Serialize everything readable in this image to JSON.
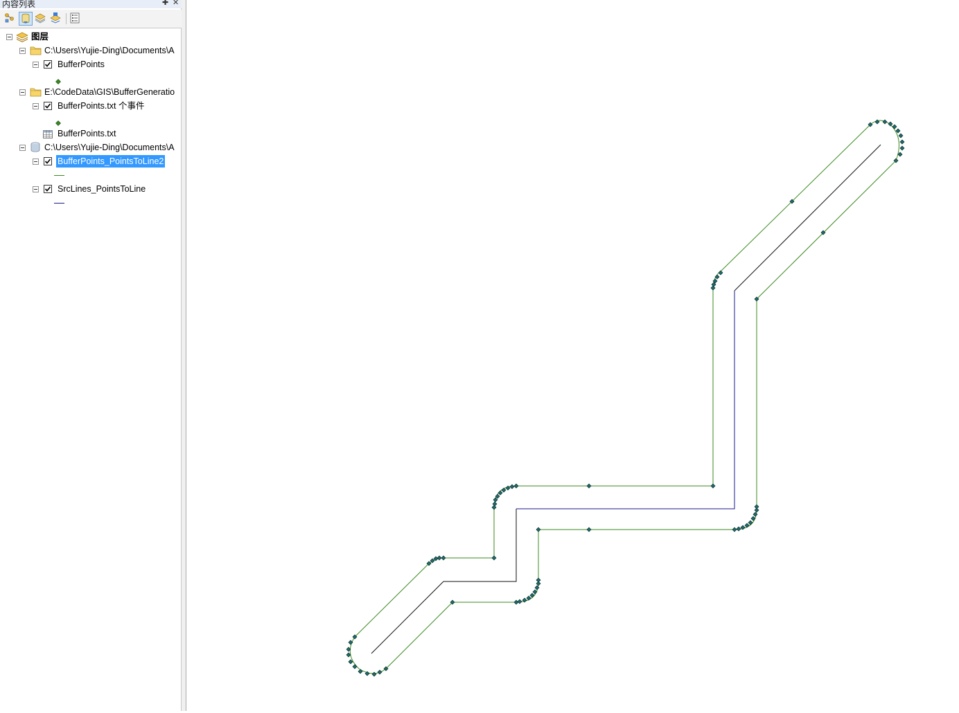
{
  "toc": {
    "title": "内容列表",
    "toolbar": [
      "list-by-drawing-order",
      "list-by-source",
      "list-by-visibility",
      "list-by-selection",
      "options"
    ],
    "root_label": "图层",
    "groups": [
      {
        "path": "C:\\Users\\Yujie-Ding\\Documents\\A",
        "icon": "folder-icon",
        "layers": [
          {
            "label": "BufferPoints",
            "checked": true,
            "symbol": "point"
          }
        ]
      },
      {
        "path": "E:\\CodeData\\GIS\\BufferGeneratio",
        "icon": "folder-icon",
        "layers": [
          {
            "label": "BufferPoints.txt 个事件",
            "checked": true,
            "symbol": "point"
          }
        ],
        "tables": [
          {
            "label": "BufferPoints.txt"
          }
        ]
      },
      {
        "path": "C:\\Users\\Yujie-Ding\\Documents\\A",
        "icon": "geodatabase-icon",
        "layers": [
          {
            "label": "BufferPoints_PointsToLine2",
            "checked": true,
            "symbol": "line",
            "selected": true
          },
          {
            "label": "SrcLines_PointsToLine",
            "checked": true,
            "symbol": "line"
          }
        ]
      }
    ]
  },
  "colors": {
    "buffer_line": "#3a8a1e",
    "src_line": "#1a1a8c",
    "point_fill": "#1f6b6b",
    "selection": "#3399ff"
  }
}
